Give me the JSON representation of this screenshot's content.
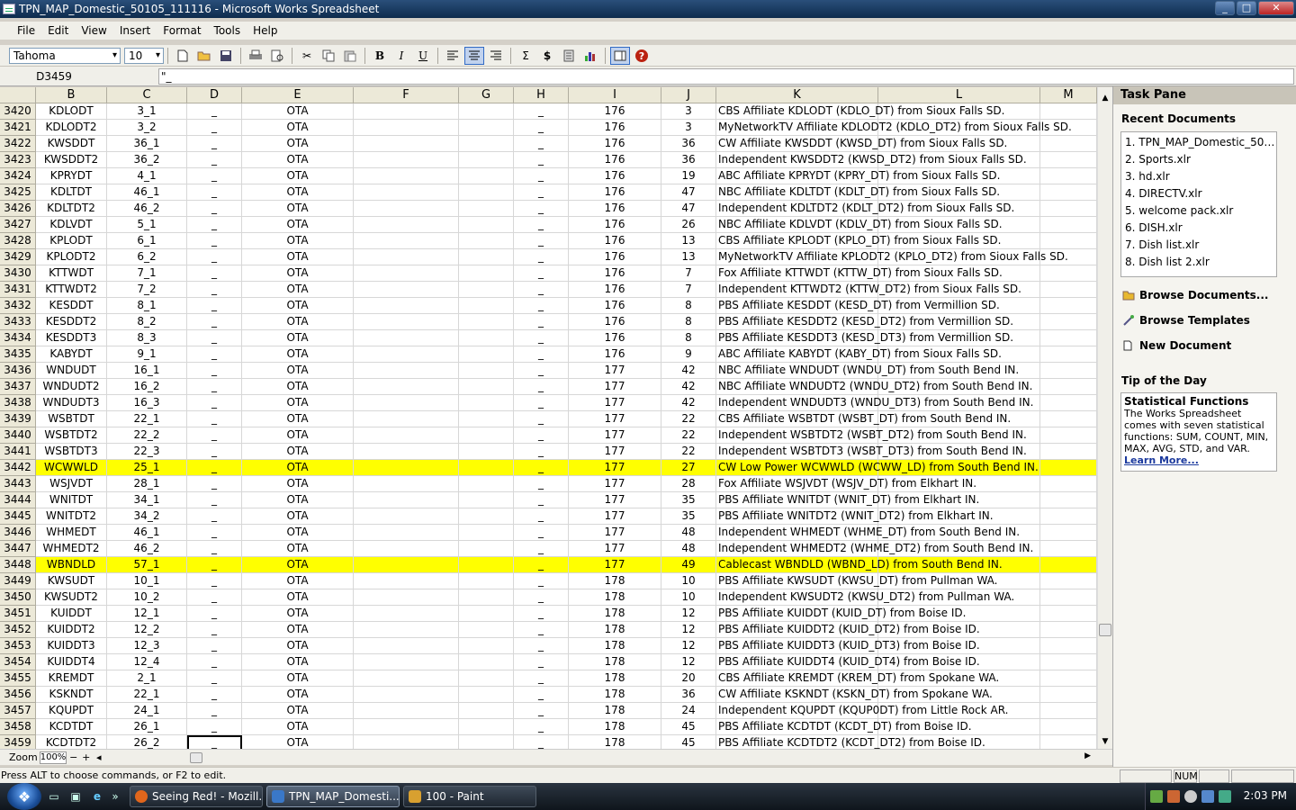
{
  "window": {
    "title": "TPN_MAP_Domestic_50105_111116 - Microsoft Works Spreadsheet",
    "min": "_",
    "max": "□",
    "close": "✕"
  },
  "menu": [
    "File",
    "Edit",
    "View",
    "Insert",
    "Format",
    "Tools",
    "Help"
  ],
  "toolbar": {
    "font": "Tahoma",
    "size": "10"
  },
  "formula": {
    "cell_ref": "D3459",
    "content": "\"_"
  },
  "columns": [
    {
      "label": "",
      "w": 40
    },
    {
      "label": "B",
      "w": 79
    },
    {
      "label": "C",
      "w": 89
    },
    {
      "label": "D",
      "w": 61
    },
    {
      "label": "E",
      "w": 124
    },
    {
      "label": "F",
      "w": 117
    },
    {
      "label": "G",
      "w": 61
    },
    {
      "label": "H",
      "w": 61
    },
    {
      "label": "I",
      "w": 103
    },
    {
      "label": "J",
      "w": 61
    },
    {
      "label": "K",
      "w": 180
    },
    {
      "label": "L",
      "w": 180
    },
    {
      "label": "M",
      "w": 63
    }
  ],
  "rows": [
    [
      "3420",
      "KDLODT",
      "3_1",
      "_",
      "OTA",
      "",
      "",
      "_",
      "176",
      "3",
      "CBS Affiliate KDLODT (KDLO_DT) from Sioux Falls SD."
    ],
    [
      "3421",
      "KDLODT2",
      "3_2",
      "_",
      "OTA",
      "",
      "",
      "_",
      "176",
      "3",
      "MyNetworkTV Affiliate KDLODT2 (KDLO_DT2) from Sioux Falls SD."
    ],
    [
      "3422",
      "KWSDDT",
      "36_1",
      "_",
      "OTA",
      "",
      "",
      "_",
      "176",
      "36",
      "CW Affiliate KWSDDT (KWSD_DT) from Sioux Falls SD."
    ],
    [
      "3423",
      "KWSDDT2",
      "36_2",
      "_",
      "OTA",
      "",
      "",
      "_",
      "176",
      "36",
      "Independent KWSDDT2 (KWSD_DT2) from Sioux Falls SD."
    ],
    [
      "3424",
      "KPRYDT",
      "4_1",
      "_",
      "OTA",
      "",
      "",
      "_",
      "176",
      "19",
      "ABC Affiliate KPRYDT (KPRY_DT) from Sioux Falls SD."
    ],
    [
      "3425",
      "KDLTDT",
      "46_1",
      "_",
      "OTA",
      "",
      "",
      "_",
      "176",
      "47",
      "NBC Affiliate KDLTDT (KDLT_DT) from Sioux Falls SD."
    ],
    [
      "3426",
      "KDLTDT2",
      "46_2",
      "_",
      "OTA",
      "",
      "",
      "_",
      "176",
      "47",
      "Independent KDLTDT2 (KDLT_DT2) from Sioux Falls SD."
    ],
    [
      "3427",
      "KDLVDT",
      "5_1",
      "_",
      "OTA",
      "",
      "",
      "_",
      "176",
      "26",
      "NBC Affiliate KDLVDT (KDLV_DT) from Sioux Falls SD."
    ],
    [
      "3428",
      "KPLODT",
      "6_1",
      "_",
      "OTA",
      "",
      "",
      "_",
      "176",
      "13",
      "CBS Affiliate KPLODT (KPLO_DT) from Sioux Falls SD."
    ],
    [
      "3429",
      "KPLODT2",
      "6_2",
      "_",
      "OTA",
      "",
      "",
      "_",
      "176",
      "13",
      "MyNetworkTV Affiliate KPLODT2 (KPLO_DT2) from Sioux Falls SD."
    ],
    [
      "3430",
      "KTTWDT",
      "7_1",
      "_",
      "OTA",
      "",
      "",
      "_",
      "176",
      "7",
      "Fox Affiliate KTTWDT (KTTW_DT) from Sioux Falls SD."
    ],
    [
      "3431",
      "KTTWDT2",
      "7_2",
      "_",
      "OTA",
      "",
      "",
      "_",
      "176",
      "7",
      "Independent KTTWDT2 (KTTW_DT2) from Sioux Falls SD."
    ],
    [
      "3432",
      "KESDDT",
      "8_1",
      "_",
      "OTA",
      "",
      "",
      "_",
      "176",
      "8",
      "PBS Affiliate KESDDT (KESD_DT) from Vermillion SD."
    ],
    [
      "3433",
      "KESDDT2",
      "8_2",
      "_",
      "OTA",
      "",
      "",
      "_",
      "176",
      "8",
      "PBS Affiliate KESDDT2 (KESD_DT2) from Vermillion SD."
    ],
    [
      "3434",
      "KESDDT3",
      "8_3",
      "_",
      "OTA",
      "",
      "",
      "_",
      "176",
      "8",
      "PBS Affiliate KESDDT3 (KESD_DT3) from Vermillion SD."
    ],
    [
      "3435",
      "KABYDT",
      "9_1",
      "_",
      "OTA",
      "",
      "",
      "_",
      "176",
      "9",
      "ABC Affiliate KABYDT (KABY_DT) from Sioux Falls SD."
    ],
    [
      "3436",
      "WNDUDT",
      "16_1",
      "_",
      "OTA",
      "",
      "",
      "_",
      "177",
      "42",
      "NBC Affiliate WNDUDT (WNDU_DT) from South Bend IN."
    ],
    [
      "3437",
      "WNDUDT2",
      "16_2",
      "_",
      "OTA",
      "",
      "",
      "_",
      "177",
      "42",
      "NBC Affiliate WNDUDT2 (WNDU_DT2) from South Bend IN."
    ],
    [
      "3438",
      "WNDUDT3",
      "16_3",
      "_",
      "OTA",
      "",
      "",
      "_",
      "177",
      "42",
      "Independent WNDUDT3 (WNDU_DT3) from South Bend IN."
    ],
    [
      "3439",
      "WSBTDT",
      "22_1",
      "_",
      "OTA",
      "",
      "",
      "_",
      "177",
      "22",
      "CBS Affiliate WSBTDT (WSBT_DT) from South Bend IN."
    ],
    [
      "3440",
      "WSBTDT2",
      "22_2",
      "_",
      "OTA",
      "",
      "",
      "_",
      "177",
      "22",
      "Independent WSBTDT2 (WSBT_DT2) from South Bend IN."
    ],
    [
      "3441",
      "WSBTDT3",
      "22_3",
      "_",
      "OTA",
      "",
      "",
      "_",
      "177",
      "22",
      "Independent WSBTDT3 (WSBT_DT3) from South Bend IN."
    ],
    [
      "3442",
      "WCWWLD",
      "25_1",
      "_",
      "OTA",
      "",
      "",
      "_",
      "177",
      "27",
      "CW Low Power WCWWLD (WCWW_LD) from South Bend IN."
    ],
    [
      "3443",
      "WSJVDT",
      "28_1",
      "_",
      "OTA",
      "",
      "",
      "_",
      "177",
      "28",
      "Fox Affiliate WSJVDT (WSJV_DT) from Elkhart IN."
    ],
    [
      "3444",
      "WNITDT",
      "34_1",
      "_",
      "OTA",
      "",
      "",
      "_",
      "177",
      "35",
      "PBS Affiliate WNITDT (WNIT_DT) from Elkhart IN."
    ],
    [
      "3445",
      "WNITDT2",
      "34_2",
      "_",
      "OTA",
      "",
      "",
      "_",
      "177",
      "35",
      "PBS Affiliate WNITDT2 (WNIT_DT2) from Elkhart IN."
    ],
    [
      "3446",
      "WHMEDT",
      "46_1",
      "_",
      "OTA",
      "",
      "",
      "_",
      "177",
      "48",
      "Independent WHMEDT (WHME_DT) from South Bend IN."
    ],
    [
      "3447",
      "WHMEDT2",
      "46_2",
      "_",
      "OTA",
      "",
      "",
      "_",
      "177",
      "48",
      "Independent WHMEDT2 (WHME_DT2) from South Bend IN."
    ],
    [
      "3448",
      "WBNDLD",
      "57_1",
      "_",
      "OTA",
      "",
      "",
      "_",
      "177",
      "49",
      "Cablecast WBNDLD (WBND_LD) from South Bend IN."
    ],
    [
      "3449",
      "KWSUDT",
      "10_1",
      "_",
      "OTA",
      "",
      "",
      "_",
      "178",
      "10",
      "PBS Affiliate KWSUDT (KWSU_DT) from Pullman WA."
    ],
    [
      "3450",
      "KWSUDT2",
      "10_2",
      "_",
      "OTA",
      "",
      "",
      "_",
      "178",
      "10",
      "Independent KWSUDT2 (KWSU_DT2) from Pullman WA."
    ],
    [
      "3451",
      "KUIDDT",
      "12_1",
      "_",
      "OTA",
      "",
      "",
      "_",
      "178",
      "12",
      "PBS Affiliate KUIDDT (KUID_DT) from Boise ID."
    ],
    [
      "3452",
      "KUIDDT2",
      "12_2",
      "_",
      "OTA",
      "",
      "",
      "_",
      "178",
      "12",
      "PBS Affiliate KUIDDT2 (KUID_DT2) from Boise ID."
    ],
    [
      "3453",
      "KUIDDT3",
      "12_3",
      "_",
      "OTA",
      "",
      "",
      "_",
      "178",
      "12",
      "PBS Affiliate KUIDDT3 (KUID_DT3) from Boise ID."
    ],
    [
      "3454",
      "KUIDDT4",
      "12_4",
      "_",
      "OTA",
      "",
      "",
      "_",
      "178",
      "12",
      "PBS Affiliate KUIDDT4 (KUID_DT4) from Boise ID."
    ],
    [
      "3455",
      "KREMDT",
      "2_1",
      "_",
      "OTA",
      "",
      "",
      "_",
      "178",
      "20",
      "CBS Affiliate KREMDT (KREM_DT) from Spokane WA."
    ],
    [
      "3456",
      "KSKNDT",
      "22_1",
      "_",
      "OTA",
      "",
      "",
      "_",
      "178",
      "36",
      "CW Affiliate KSKNDT (KSKN_DT) from Spokane WA."
    ],
    [
      "3457",
      "KQUPDT",
      "24_1",
      "_",
      "OTA",
      "",
      "",
      "_",
      "178",
      "24",
      "Independent KQUPDT (KQUP0DT) from Little Rock AR."
    ],
    [
      "3458",
      "KCDTDT",
      "26_1",
      "_",
      "OTA",
      "",
      "",
      "_",
      "178",
      "45",
      "PBS Affiliate KCDTDT (KCDT_DT) from Boise ID."
    ],
    [
      "3459",
      "KCDTDT2",
      "26_2",
      "_",
      "OTA",
      "",
      "",
      "_",
      "178",
      "45",
      "PBS Affiliate KCDTDT2 (KCDT_DT2) from Boise ID."
    ]
  ],
  "highlighted_rows": [
    "3442",
    "3448"
  ],
  "highlight_color": "#ffff00",
  "selected_cell": {
    "row": "3459",
    "col": "D"
  },
  "zoom": {
    "label": "Zoom",
    "value": "100%",
    "minus": "−",
    "plus": "+"
  },
  "taskpane": {
    "title": "Task Pane",
    "recent_title": "Recent Documents",
    "recent": [
      "1. TPN_MAP_Domestic_5010...",
      "2. Sports.xlr",
      "3. hd.xlr",
      "4. DIRECTV.xlr",
      "5. welcome pack.xlr",
      "6. DISH.xlr",
      "7. Dish list.xlr",
      "8. Dish list 2.xlr"
    ],
    "browse_documents": "Browse Documents...",
    "browse_templates": "Browse Templates",
    "new_document": "New Document",
    "tip_title": "Tip of the Day",
    "tip_heading": "Statistical Functions",
    "tip_body": "The Works Spreadsheet comes with seven statistical functions: SUM, COUNT, MIN, MAX, AVG, STD, and VAR.",
    "tip_link": "Learn More..."
  },
  "status": {
    "text": "Press ALT to choose commands, or F2 to edit.",
    "num": "NUM"
  },
  "taskbar": {
    "buttons": [
      {
        "label": "Seeing Red! - Mozill...",
        "color": "#e0661c"
      },
      {
        "label": "TPN_MAP_Domesti...",
        "color": "#3a78c8"
      },
      {
        "label": "100 - Paint",
        "color": "#d8a030"
      }
    ],
    "clock": "2:03 PM"
  }
}
